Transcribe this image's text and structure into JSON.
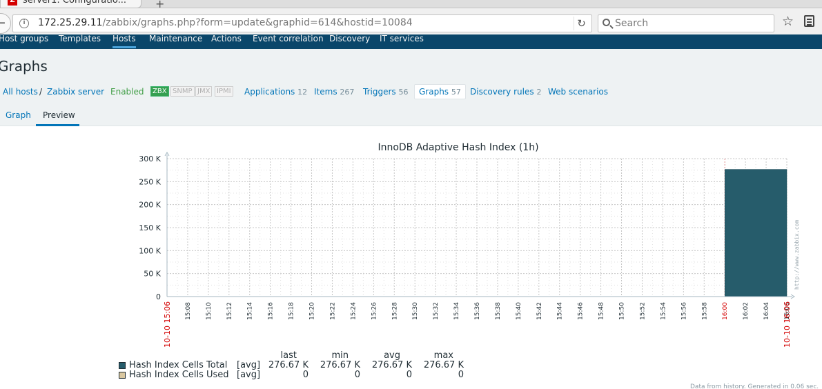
{
  "browser": {
    "tab_title": "server1: Configuratio...",
    "url_host": "172.25.29.11",
    "url_path": "/zabbix/graphs.php?form=update&graphid=614&hostid=10084",
    "search_placeholder": "Search"
  },
  "menu": {
    "items": [
      "Host groups",
      "Templates",
      "Hosts",
      "Maintenance",
      "Actions",
      "Event correlation",
      "Discovery",
      "IT services"
    ],
    "active": "Hosts"
  },
  "page": {
    "title": "Graphs"
  },
  "hostbar": {
    "all_hosts": "All hosts",
    "separator": "/",
    "host": "Zabbix server",
    "status": "Enabled",
    "availability": [
      "ZBX",
      "SNMP",
      "JMX",
      "IPMI"
    ],
    "tabs": [
      {
        "label": "Applications",
        "count": "12"
      },
      {
        "label": "Items",
        "count": "267"
      },
      {
        "label": "Triggers",
        "count": "56"
      },
      {
        "label": "Graphs",
        "count": "57"
      },
      {
        "label": "Discovery rules",
        "count": "2"
      },
      {
        "label": "Web scenarios",
        "count": ""
      }
    ]
  },
  "form_tabs": [
    "Graph",
    "Preview"
  ],
  "chart_data": {
    "type": "bar",
    "title": "InnoDB Adaptive Hash Index (1h)",
    "y_ticks": [
      "300 K",
      "250 K",
      "200 K",
      "150 K",
      "100 K",
      "50 K",
      "0"
    ],
    "ylim": [
      0,
      300000
    ],
    "x_ticks": [
      "15:08",
      "15:10",
      "15:12",
      "15:14",
      "15:16",
      "15:18",
      "15:20",
      "15:22",
      "15:24",
      "15:26",
      "15:28",
      "15:30",
      "15:32",
      "15:34",
      "15:36",
      "15:38",
      "15:40",
      "15:42",
      "15:44",
      "15:46",
      "15:48",
      "15:50",
      "15:52",
      "15:54",
      "15:56",
      "15:58",
      "16:00",
      "16:02",
      "16:04",
      "16:06"
    ],
    "x_start_label": "10-10 15:06",
    "x_end_label": "10-10 16:06",
    "highlight_tick": "16:00",
    "series": [
      {
        "name": "Hash Index Cells Total",
        "color": "#265c6b",
        "from": "16:00",
        "to": "16:06",
        "value": 276670
      },
      {
        "name": "Hash Index Cells Used",
        "color": "#d9c7a0",
        "value": 0
      }
    ],
    "grid": true
  },
  "legend": {
    "headers": [
      "last",
      "min",
      "avg",
      "max"
    ],
    "rows": [
      {
        "name": "Hash Index Cells Total",
        "func": "[avg]",
        "last": "276.67 K",
        "min": "276.67 K",
        "avg": "276.67 K",
        "max": "276.67 K",
        "color": "#265c6b"
      },
      {
        "name": "Hash Index Cells Used",
        "func": "[avg]",
        "last": "0",
        "min": "0",
        "avg": "0",
        "max": "0",
        "color": "#d9c7a0"
      }
    ]
  },
  "footer_note": "Data from history. Generated in 0.06 sec.",
  "watermark": "http://www.zabbix.com"
}
